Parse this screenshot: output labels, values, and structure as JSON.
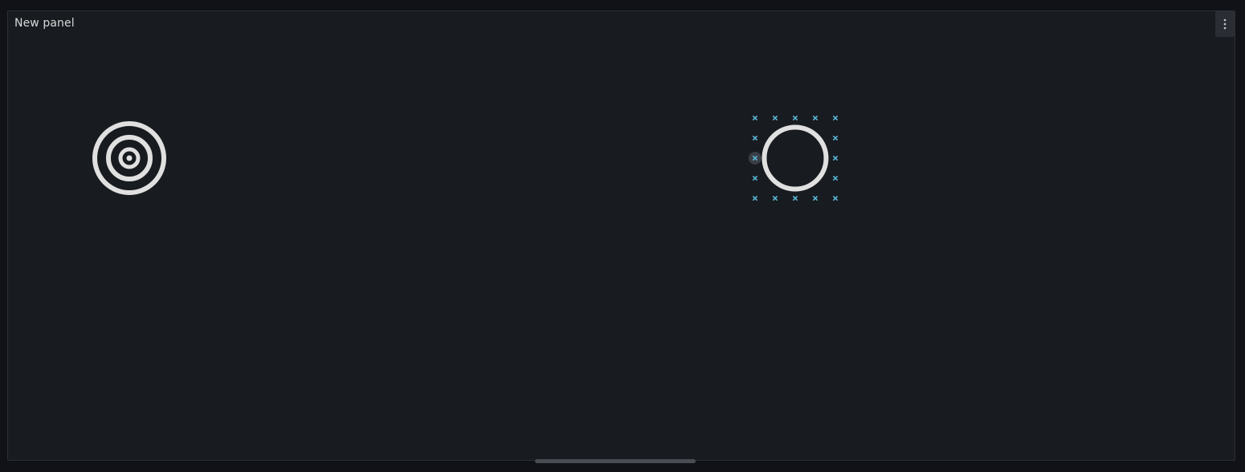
{
  "panel": {
    "title": "New panel",
    "menu_icon": "kebab-vertical-icon"
  },
  "elements": [
    {
      "name": "target-icon",
      "icon": "bullseye"
    },
    {
      "name": "selected-circle",
      "icon": "circle",
      "selected": true
    }
  ],
  "colors": {
    "background": "#111217",
    "panel": "#181b1f",
    "shape": "#e0e0e0",
    "handle": "#5ab4d6"
  }
}
